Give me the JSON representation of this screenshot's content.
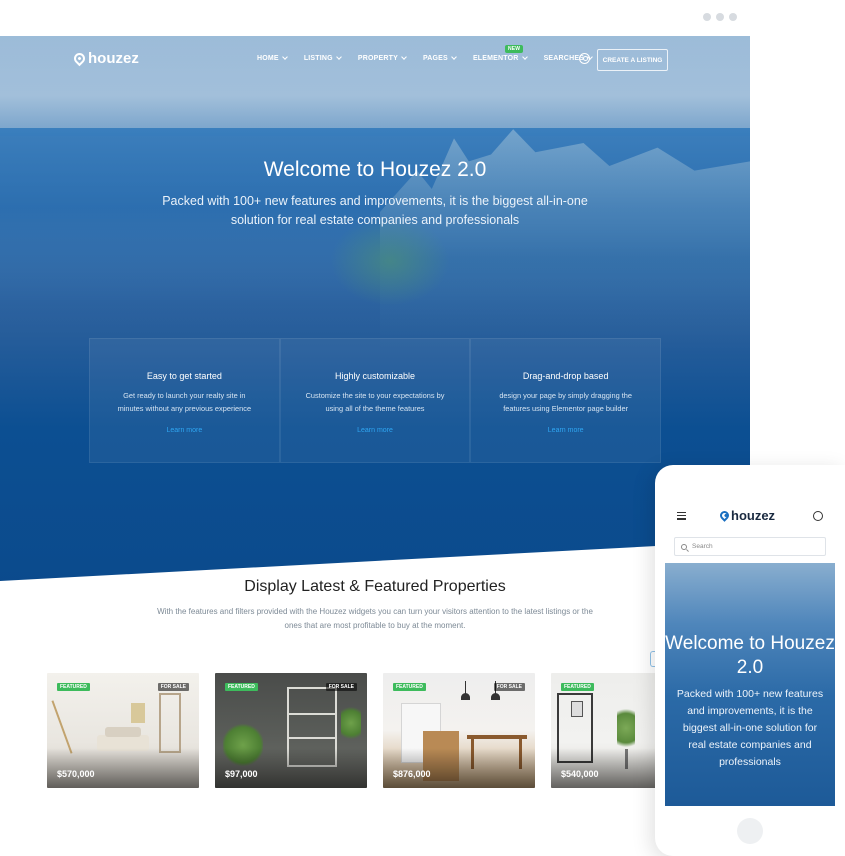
{
  "desktop": {
    "logo": "houzez",
    "nav": {
      "items": [
        "HOME",
        "LISTING",
        "PROPERTY",
        "PAGES",
        "ELEMENTOR",
        "SEARCHES"
      ],
      "new_badge": "NEW",
      "cta": "CREATE A LISTING"
    },
    "hero": {
      "title": "Welcome to Houzez 2.0",
      "subtitle": "Packed with 100+ new features and improvements, it is the biggest all-in-one solution for real estate companies and professionals"
    },
    "features": [
      {
        "title": "Easy to get started",
        "text": "Get ready to launch your realty site in minutes without any previous experience",
        "link": "Learn more"
      },
      {
        "title": "Highly customizable",
        "text": "Customize the site to your expectations by using all of the theme features",
        "link": "Learn more"
      },
      {
        "title": "Drag-and-drop based",
        "text": "design your page by simply dragging the features using Elementor page builder",
        "link": "Learn more"
      }
    ],
    "section": {
      "title": "Display Latest & Featured Properties",
      "subtitle": "With the features and filters provided with the Houzez widgets you can turn your visitors attention to the latest listings or the ones that are most profitable to buy at the moment."
    },
    "cards": [
      {
        "featured": "FEATURED",
        "status": "FOR SALE",
        "price": "$570,000"
      },
      {
        "featured": "FEATURED",
        "status": "FOR SALE",
        "price": "$97,000"
      },
      {
        "featured": "FEATURED",
        "status": "FOR SALE",
        "price": "$876,000"
      },
      {
        "featured": "FEATURED",
        "status": "",
        "price": "$540,000"
      }
    ]
  },
  "mobile": {
    "logo": "houzez",
    "search_placeholder": "Search",
    "hero_title": "Welcome to Houzez 2.0",
    "hero_subtitle": "Packed with 100+ new features and improvements, it is the biggest all-in-one solution for real estate companies and professionals"
  },
  "colors": {
    "accent": "#2fa6f2",
    "featured": "#3dbb5c",
    "hero": "#0c4f92"
  }
}
